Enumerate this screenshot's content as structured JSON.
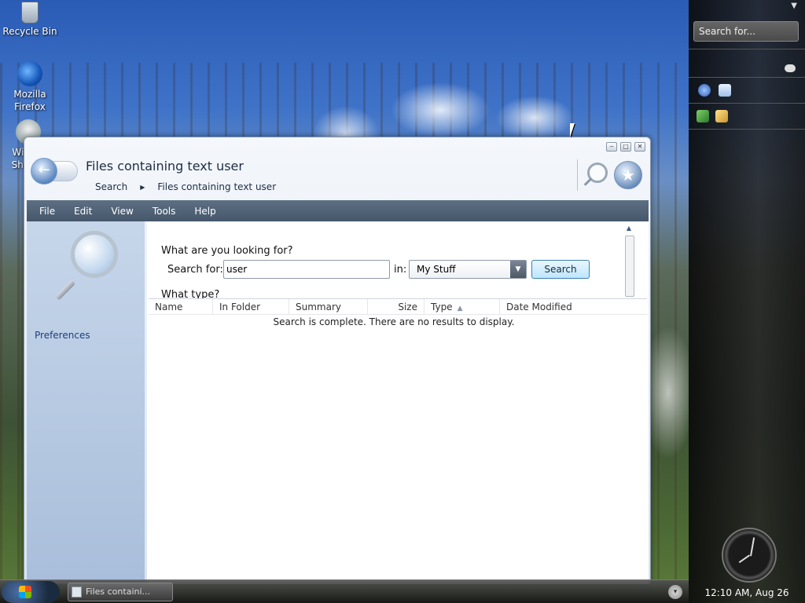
{
  "desktop": {
    "icons": [
      {
        "label": "Recycle Bin",
        "icon": "recycle-bin-icon"
      },
      {
        "label": "Mozilla Firefox",
        "icon": "firefox-icon"
      },
      {
        "label": "Wis Shu",
        "icon": "shortcut-icon"
      }
    ]
  },
  "sidebar": {
    "search_placeholder": "Search for...",
    "time": "12:10 AM, Aug 26"
  },
  "window": {
    "title": "Files containing text user",
    "breadcrumb": [
      "Search",
      "Files containing text user"
    ],
    "controls": [
      "minimize",
      "maximize",
      "close"
    ]
  },
  "menu": [
    "File",
    "Edit",
    "View",
    "Tools",
    "Help"
  ],
  "left_pane": {
    "preferences_label": "Preferences"
  },
  "search_form": {
    "heading": "What are you looking for?",
    "search_label": "Search for:",
    "search_value": "user",
    "in_label": "in:",
    "scope_value": "My Stuff",
    "search_button": "Search",
    "type_heading": "What type?"
  },
  "results": {
    "columns": [
      "Name",
      "In Folder",
      "Summary",
      "Size",
      "Type",
      "Date Modified"
    ],
    "sorted_by": "Type",
    "message": "Search is complete. There are no results to display."
  },
  "taskbar": {
    "task_label": "Files containi..."
  }
}
